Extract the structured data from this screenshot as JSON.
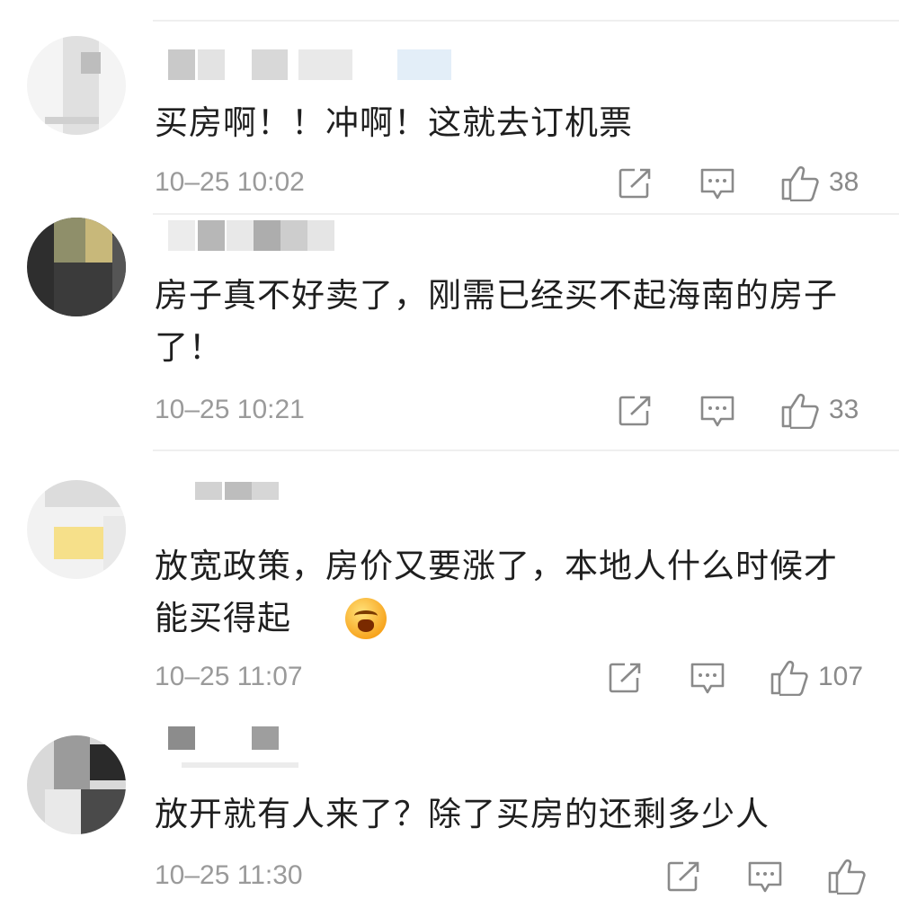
{
  "comments": [
    {
      "text": "买房啊！！冲啊！这就去订机票",
      "time": "10–25 10:02",
      "likes": "38"
    },
    {
      "text": "房子真不好卖了，刚需已经买不起海南的房子了！",
      "time": "10–25 10:21",
      "likes": "33"
    },
    {
      "text": "放宽政策，房价又要涨了，本地人什么时候才能买得起",
      "time": "10–25 11:07",
      "likes": "107"
    },
    {
      "text": "放开就有人来了？除了买房的还剩多少人",
      "time": "10–25 11:30",
      "likes": ""
    }
  ],
  "icons": {
    "share": "share-icon",
    "reply": "comment-icon",
    "like": "thumbs-up-icon"
  },
  "colors": {
    "text": "#1f1f1f",
    "meta": "#9a9a9a",
    "icon": "#8a8a8a"
  }
}
